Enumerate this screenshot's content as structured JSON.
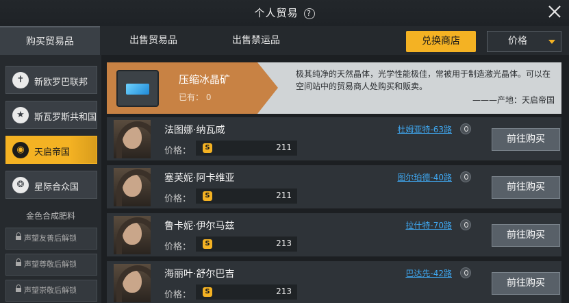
{
  "header": {
    "title": "个人贸易",
    "help_icon": "help-icon",
    "close_icon": "close-icon"
  },
  "tabs": [
    {
      "label": "购买贸易品",
      "active": true
    },
    {
      "label": "出售贸易品",
      "active": false
    },
    {
      "label": "出售禁运品",
      "active": false
    }
  ],
  "toolbar": {
    "exchange_label": "兑换商店",
    "sort_value": "价格",
    "accent": "#f4b223"
  },
  "sidebar": {
    "factions": [
      {
        "label": "新欧罗巴联邦",
        "icon": "cross-emblem-icon",
        "glyph": "✝"
      },
      {
        "label": "斯瓦罗斯共和国",
        "icon": "star-emblem-icon",
        "glyph": "★"
      },
      {
        "label": "天启帝国",
        "icon": "orb-emblem-icon",
        "glyph": "◉",
        "active": true
      },
      {
        "label": "星际合众国",
        "icon": "eagle-emblem-icon",
        "glyph": "❂"
      }
    ],
    "section_label": "金色合成肥料",
    "locked": [
      "声望友善后解锁",
      "声望尊敬后解锁",
      "声望崇敬后解锁"
    ]
  },
  "item": {
    "name": "压缩冰晶矿",
    "owned_label": "已有：",
    "owned_value": "0",
    "description": "极其纯净的天然晶体，光学性能极佳，常被用于制造激光晶体。可以在空间站中的贸易商人处购买和贩卖。",
    "origin": "———产地：天启帝国"
  },
  "traders": [
    {
      "name": "法图娜·纳瓦威",
      "price_label": "价格：",
      "price": "211",
      "location": "杜姆亚特-63路",
      "action": "前往购买"
    },
    {
      "name": "塞芙妮·阿卡维亚",
      "price_label": "价格：",
      "price": "211",
      "location": "图尔珀德-40路",
      "action": "前往购买"
    },
    {
      "name": "鲁卡妮·伊尔马兹",
      "price_label": "价格：",
      "price": "213",
      "location": "拉什特-70路",
      "action": "前往购买"
    },
    {
      "name": "海丽叶·舒尔巴吉",
      "price_label": "价格：",
      "price": "213",
      "location": "巴达先-42路",
      "action": "前往购买"
    }
  ]
}
